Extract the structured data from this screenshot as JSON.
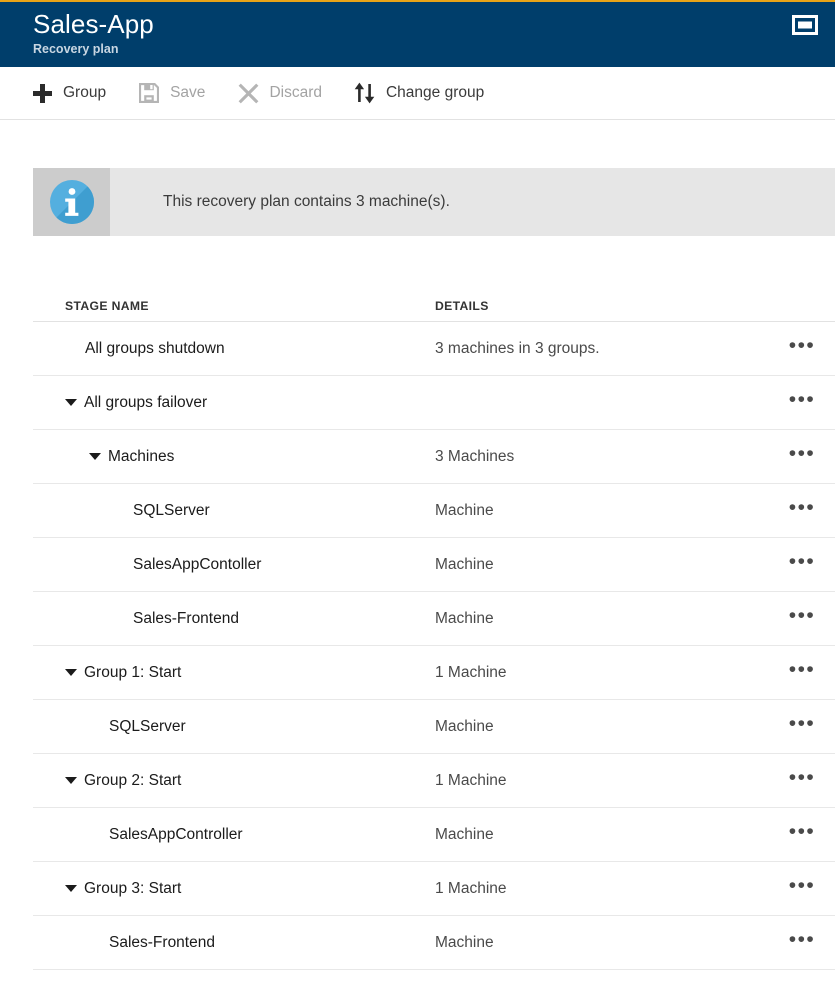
{
  "theme": {
    "accent_bar_color": "#e8a317",
    "header_bg": "#003e6b",
    "info_bar_bg": "#e6e6e6",
    "info_icon_box_bg": "#cccccc",
    "info_icon_color": "#4aa3d8"
  },
  "header": {
    "title": "Sales-App",
    "subtitle": "Recovery plan",
    "window_button_name": "restore-window"
  },
  "toolbar": {
    "items": [
      {
        "label": "Group",
        "icon": "plus-icon",
        "disabled": false
      },
      {
        "label": "Save",
        "icon": "save-icon",
        "disabled": true
      },
      {
        "label": "Discard",
        "icon": "close-icon",
        "disabled": true
      },
      {
        "label": "Change group",
        "icon": "swap-arrows-icon",
        "disabled": false
      }
    ]
  },
  "info": {
    "icon": "info-icon",
    "message": "This recovery plan contains 3 machine(s)."
  },
  "table": {
    "columns": {
      "stage_name": "STAGE NAME",
      "details": "DETAILS"
    },
    "action_label": "•••",
    "rows": [
      {
        "name": "All groups shutdown",
        "details": "3 machines in 3 groups.",
        "indent": 0,
        "expandable": false,
        "expanded": false
      },
      {
        "name": "All groups failover",
        "details": "",
        "indent": 0,
        "expandable": true,
        "expanded": true
      },
      {
        "name": "Machines",
        "details": "3 Machines",
        "indent": 1,
        "expandable": true,
        "expanded": true
      },
      {
        "name": "SQLServer",
        "details": "Machine",
        "indent": 2,
        "expandable": false,
        "expanded": false
      },
      {
        "name": "SalesAppContoller",
        "details": "Machine",
        "indent": 2,
        "expandable": false,
        "expanded": false
      },
      {
        "name": "Sales-Frontend",
        "details": "Machine",
        "indent": 2,
        "expandable": false,
        "expanded": false
      },
      {
        "name": "Group 1: Start",
        "details": "1 Machine",
        "indent": 0,
        "expandable": true,
        "expanded": true
      },
      {
        "name": "SQLServer",
        "details": "Machine",
        "indent": 1,
        "expandable": false,
        "expanded": false
      },
      {
        "name": "Group 2: Start",
        "details": "1 Machine",
        "indent": 0,
        "expandable": true,
        "expanded": true
      },
      {
        "name": "SalesAppController",
        "details": "Machine",
        "indent": 1,
        "expandable": false,
        "expanded": false
      },
      {
        "name": "Group 3: Start",
        "details": "1 Machine",
        "indent": 0,
        "expandable": true,
        "expanded": true
      },
      {
        "name": "Sales-Frontend",
        "details": "Machine",
        "indent": 1,
        "expandable": false,
        "expanded": false
      }
    ]
  }
}
